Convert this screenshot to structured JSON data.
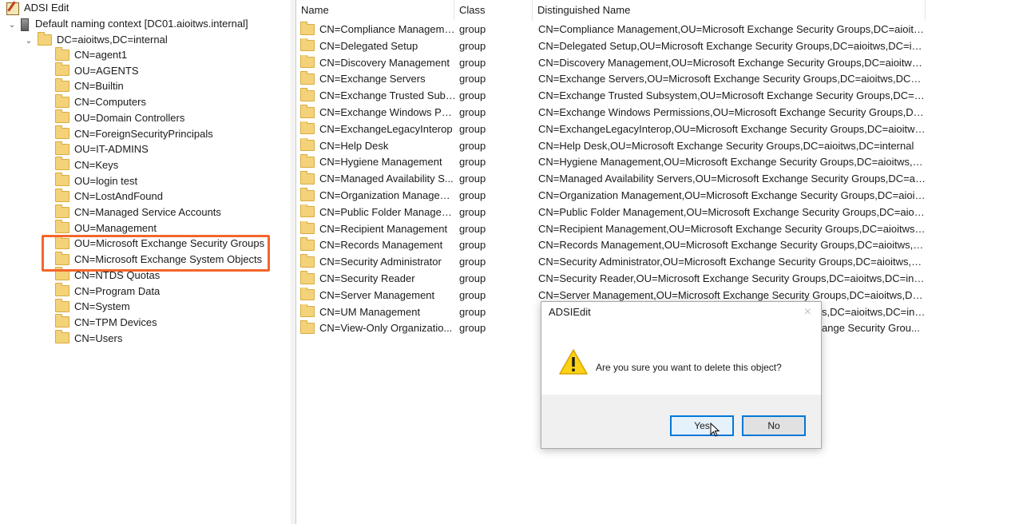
{
  "tree": {
    "root_label": "ADSI Edit",
    "context_label": "Default naming context [DC01.aioitws.internal]",
    "domain_label": "DC=aioitws,DC=internal",
    "items": [
      {
        "label": "CN=agent1"
      },
      {
        "label": "OU=AGENTS"
      },
      {
        "label": "CN=Builtin"
      },
      {
        "label": "CN=Computers"
      },
      {
        "label": "OU=Domain Controllers"
      },
      {
        "label": "CN=ForeignSecurityPrincipals"
      },
      {
        "label": "OU=IT-ADMINS"
      },
      {
        "label": "CN=Keys"
      },
      {
        "label": "OU=login test"
      },
      {
        "label": "CN=LostAndFound"
      },
      {
        "label": "CN=Managed Service Accounts"
      },
      {
        "label": "OU=Management"
      },
      {
        "label": "OU=Microsoft Exchange Security Groups"
      },
      {
        "label": "CN=Microsoft Exchange System Objects"
      },
      {
        "label": "CN=NTDS Quotas"
      },
      {
        "label": "CN=Program Data"
      },
      {
        "label": "CN=System"
      },
      {
        "label": "CN=TPM Devices"
      },
      {
        "label": "CN=Users"
      }
    ]
  },
  "list": {
    "columns": [
      "Name",
      "Class",
      "Distinguished Name"
    ],
    "rows": [
      {
        "name": "CN=Compliance Manageme...",
        "cls": "group",
        "dn": "CN=Compliance Management,OU=Microsoft Exchange Security Groups,DC=aioitw..."
      },
      {
        "name": "CN=Delegated Setup",
        "cls": "group",
        "dn": "CN=Delegated Setup,OU=Microsoft Exchange Security Groups,DC=aioitws,DC=inte..."
      },
      {
        "name": "CN=Discovery Management",
        "cls": "group",
        "dn": "CN=Discovery Management,OU=Microsoft Exchange Security Groups,DC=aioitws,..."
      },
      {
        "name": "CN=Exchange Servers",
        "cls": "group",
        "dn": "CN=Exchange Servers,OU=Microsoft Exchange Security Groups,DC=aioitws,DC=int..."
      },
      {
        "name": "CN=Exchange Trusted Subsy...",
        "cls": "group",
        "dn": "CN=Exchange Trusted Subsystem,OU=Microsoft Exchange Security Groups,DC=aio..."
      },
      {
        "name": "CN=Exchange Windows Per...",
        "cls": "group",
        "dn": "CN=Exchange Windows Permissions,OU=Microsoft Exchange Security Groups,DC=..."
      },
      {
        "name": "CN=ExchangeLegacyInterop",
        "cls": "group",
        "dn": "CN=ExchangeLegacyInterop,OU=Microsoft Exchange Security Groups,DC=aioitws,..."
      },
      {
        "name": "CN=Help Desk",
        "cls": "group",
        "dn": "CN=Help Desk,OU=Microsoft Exchange Security Groups,DC=aioitws,DC=internal"
      },
      {
        "name": "CN=Hygiene Management",
        "cls": "group",
        "dn": "CN=Hygiene Management,OU=Microsoft Exchange Security Groups,DC=aioitws,D..."
      },
      {
        "name": "CN=Managed Availability S...",
        "cls": "group",
        "dn": "CN=Managed Availability Servers,OU=Microsoft Exchange Security Groups,DC=aio..."
      },
      {
        "name": "CN=Organization Managem...",
        "cls": "group",
        "dn": "CN=Organization Management,OU=Microsoft Exchange Security Groups,DC=aioit..."
      },
      {
        "name": "CN=Public Folder Managem...",
        "cls": "group",
        "dn": "CN=Public Folder Management,OU=Microsoft Exchange Security Groups,DC=aioit..."
      },
      {
        "name": "CN=Recipient Management",
        "cls": "group",
        "dn": "CN=Recipient Management,OU=Microsoft Exchange Security Groups,DC=aioitws,D..."
      },
      {
        "name": "CN=Records Management",
        "cls": "group",
        "dn": "CN=Records Management,OU=Microsoft Exchange Security Groups,DC=aioitws,DC..."
      },
      {
        "name": "CN=Security Administrator",
        "cls": "group",
        "dn": "CN=Security Administrator,OU=Microsoft Exchange Security Groups,DC=aioitws,D..."
      },
      {
        "name": "CN=Security Reader",
        "cls": "group",
        "dn": "CN=Security Reader,OU=Microsoft Exchange Security Groups,DC=aioitws,DC=inter..."
      },
      {
        "name": "CN=Server Management",
        "cls": "group",
        "dn": "CN=Server Management,OU=Microsoft Exchange Security Groups,DC=aioitws,DC=..."
      },
      {
        "name": "CN=UM Management",
        "cls": "group",
        "dn": "s,DC=aioitws,DC=int..."
      },
      {
        "name": "CN=View-Only Organizatio...",
        "cls": "group",
        "dn": "ange Security Grou..."
      }
    ]
  },
  "dialog": {
    "title": "ADSIEdit",
    "close": "×",
    "message": "Are you sure you want to delete this object?",
    "yes_label": "Yes",
    "no_label": "No"
  },
  "colors": {
    "highlight": "#f2662b",
    "focus": "#0078d7"
  }
}
